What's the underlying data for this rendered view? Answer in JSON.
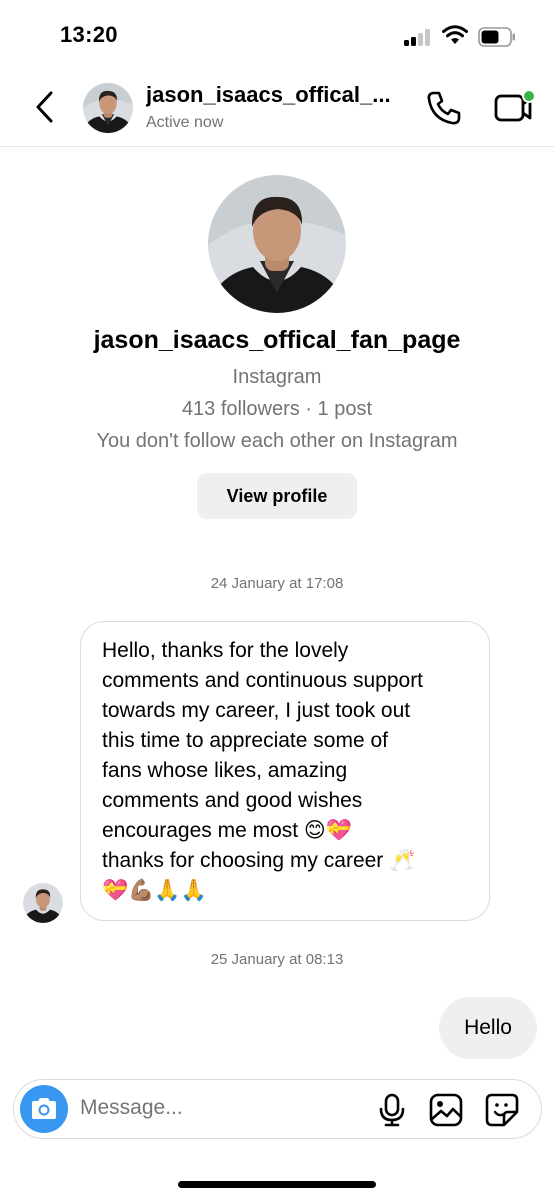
{
  "status_bar": {
    "time": "13:20"
  },
  "header": {
    "username": "jason_isaacs_offical_...",
    "status": "Active now",
    "online_dot_color": "#3ab54a"
  },
  "profile": {
    "username": "jason_isaacs_offical_fan_page",
    "platform": "Instagram",
    "stats": "413 followers · 1 post",
    "relationship": "You don't follow each other on Instagram",
    "view_profile_label": "View profile"
  },
  "messages": [
    {
      "timestamp": "24 January at 17:08",
      "direction": "incoming",
      "lines": [
        "Hello, thanks for the lovely",
        "comments and continuous support",
        "towards my career, I just took out",
        "this time to appreciate some of",
        "fans whose likes, amazing",
        "comments and good wishes",
        "encourages me most 😊💝",
        "thanks for choosing my career 🥂",
        "💝💪🏽🙏🙏"
      ]
    },
    {
      "timestamp": "25 January at 08:13",
      "direction": "outgoing",
      "text": "Hello"
    }
  ],
  "composer": {
    "placeholder": "Message...",
    "icons": [
      "camera-icon",
      "microphone-icon",
      "gallery-icon",
      "sticker-icon"
    ]
  },
  "colors": {
    "accent_blue": "#3897f0",
    "secondary_text": "#737373"
  }
}
